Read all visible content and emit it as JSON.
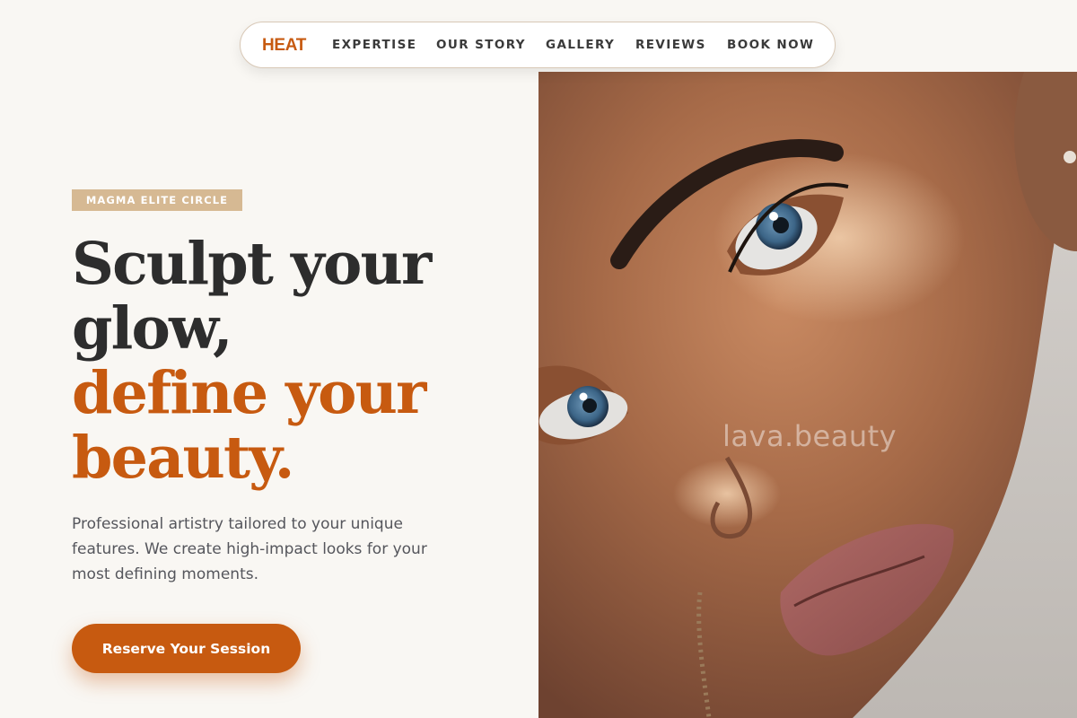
{
  "nav": {
    "brand": "HEAT",
    "links": [
      "EXPERTISE",
      "OUR STORY",
      "GALLERY",
      "REVIEWS",
      "BOOK NOW"
    ]
  },
  "hero": {
    "badge": "MAGMA ELITE CIRCLE",
    "headline_line1": "Sculpt your",
    "headline_line2": "glow,",
    "headline_accent_line1": "define your",
    "headline_accent_line2": "beauty.",
    "description": "Professional artistry tailored to your unique features. We create high-impact looks for your most defining moments.",
    "cta_label": "Reserve Your Session"
  },
  "photo": {
    "watermark": "lava.beauty"
  },
  "colors": {
    "accent": "#c75a10",
    "badge_bg": "#d6b993",
    "page_bg": "#f9f7f3",
    "heading": "#2d2d2d"
  }
}
